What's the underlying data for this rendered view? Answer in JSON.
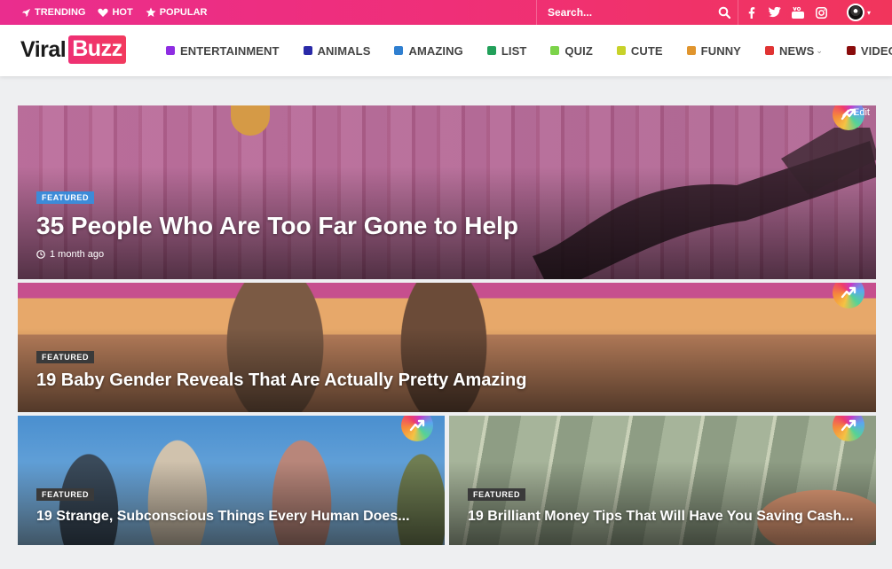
{
  "topbar": {
    "links": [
      {
        "label": "TRENDING",
        "icon": "rocket-icon"
      },
      {
        "label": "HOT",
        "icon": "heart-icon"
      },
      {
        "label": "POPULAR",
        "icon": "star-icon"
      }
    ],
    "search_placeholder": "Search...",
    "socials": [
      "facebook-icon",
      "twitter-icon",
      "youtube-icon",
      "instagram-icon"
    ]
  },
  "brand": {
    "part1": "Viral",
    "part2": "Buzz"
  },
  "nav": [
    {
      "label": "ENTERTAINMENT",
      "color": "#8e2de2",
      "dropdown": false
    },
    {
      "label": "ANIMALS",
      "color": "#2a2aa8",
      "dropdown": false
    },
    {
      "label": "AMAZING",
      "color": "#2f7fd0",
      "dropdown": false
    },
    {
      "label": "LIST",
      "color": "#22a05a",
      "dropdown": false
    },
    {
      "label": "QUIZ",
      "color": "#7cd34a",
      "dropdown": false
    },
    {
      "label": "CUTE",
      "color": "#c8d22a",
      "dropdown": false
    },
    {
      "label": "FUNNY",
      "color": "#e0952e",
      "dropdown": false
    },
    {
      "label": "NEWS",
      "color": "#e03333",
      "dropdown": true
    },
    {
      "label": "VIDEO",
      "color": "#8a0c0c",
      "dropdown": true
    }
  ],
  "featured": [
    {
      "badge": "FEATURED",
      "badge_color": "#3d8bd8",
      "title": "35 People Who Are Too Far Gone to Help",
      "meta": "1 month ago",
      "edit": "Edit"
    },
    {
      "badge": "FEATURED",
      "badge_color": "#3a3a3a",
      "title": "19 Baby Gender Reveals That Are Actually Pretty Amazing"
    },
    {
      "badge": "FEATURED",
      "badge_color": "#3a3a3a",
      "title": "19 Strange, Subconscious Things Every Human Does..."
    },
    {
      "badge": "FEATURED",
      "badge_color": "#3a3a3a",
      "title": "19 Brilliant Money Tips That Will Have You Saving Cash..."
    }
  ]
}
